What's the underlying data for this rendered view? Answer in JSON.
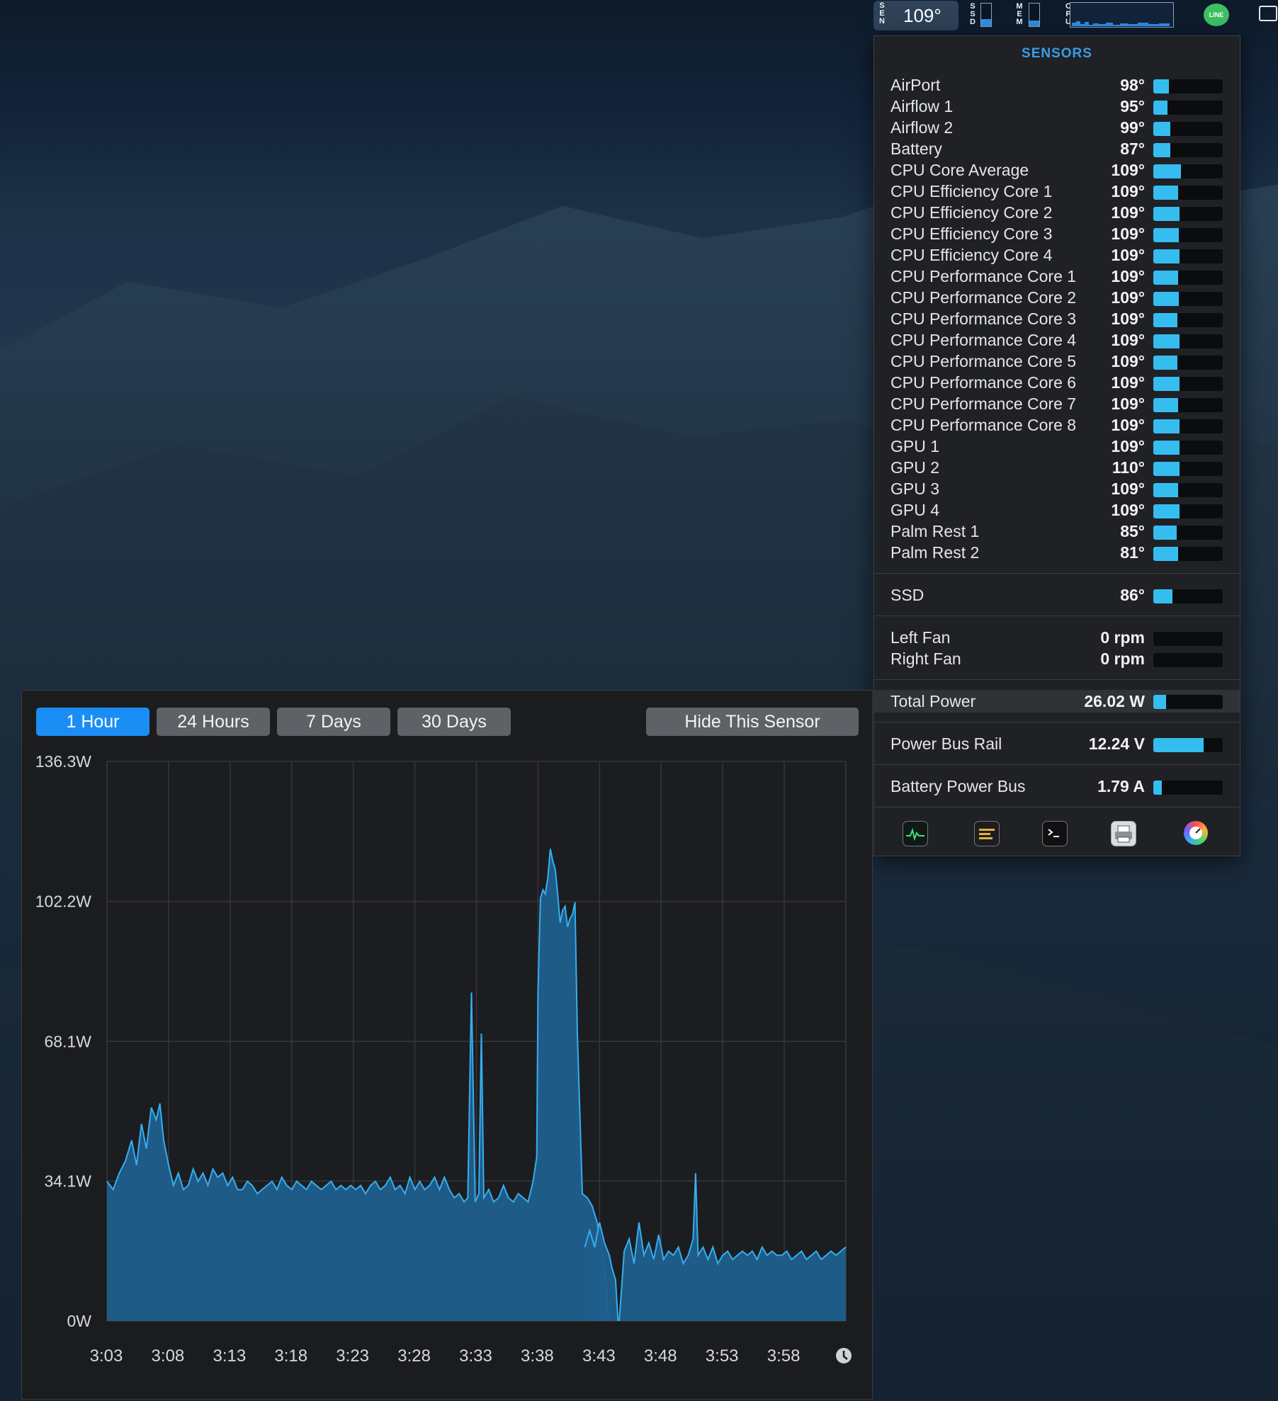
{
  "menubar": {
    "sensor_letters": [
      "S",
      "E",
      "N"
    ],
    "sensor_temp": "109°",
    "ssd_letters": [
      "S",
      "S",
      "D"
    ],
    "mem_letters": [
      "M",
      "E",
      "M"
    ],
    "cpu_letters": [
      "C",
      "P",
      "U"
    ],
    "ssd_level": 0.3,
    "mem_level": 0.25,
    "line_app_label": "LINE",
    "display_icon": "display-icon"
  },
  "sensors_panel": {
    "title": "SENSORS",
    "temperatures": [
      {
        "label": "AirPort",
        "value": "98°",
        "level": 0.22
      },
      {
        "label": "Airflow 1",
        "value": "95°",
        "level": 0.2
      },
      {
        "label": "Airflow 2",
        "value": "99°",
        "level": 0.24
      },
      {
        "label": "Battery",
        "value": "87°",
        "level": 0.24
      },
      {
        "label": "CPU Core Average",
        "value": "109°",
        "level": 0.4
      },
      {
        "label": "CPU Efficiency Core 1",
        "value": "109°",
        "level": 0.36
      },
      {
        "label": "CPU Efficiency Core 2",
        "value": "109°",
        "level": 0.38
      },
      {
        "label": "CPU Efficiency Core 3",
        "value": "109°",
        "level": 0.37
      },
      {
        "label": "CPU Efficiency Core 4",
        "value": "109°",
        "level": 0.38
      },
      {
        "label": "CPU Performance Core 1",
        "value": "109°",
        "level": 0.36
      },
      {
        "label": "CPU Performance Core 2",
        "value": "109°",
        "level": 0.37
      },
      {
        "label": "CPU Performance Core 3",
        "value": "109°",
        "level": 0.35
      },
      {
        "label": "CPU Performance Core 4",
        "value": "109°",
        "level": 0.38
      },
      {
        "label": "CPU Performance Core 5",
        "value": "109°",
        "level": 0.35
      },
      {
        "label": "CPU Performance Core 6",
        "value": "109°",
        "level": 0.38
      },
      {
        "label": "CPU Performance Core 7",
        "value": "109°",
        "level": 0.36
      },
      {
        "label": "CPU Performance Core 8",
        "value": "109°",
        "level": 0.38
      },
      {
        "label": "GPU 1",
        "value": "109°",
        "level": 0.38
      },
      {
        "label": "GPU 2",
        "value": "110°",
        "level": 0.38
      },
      {
        "label": "GPU 3",
        "value": "109°",
        "level": 0.36
      },
      {
        "label": "GPU 4",
        "value": "109°",
        "level": 0.38
      },
      {
        "label": "Palm Rest 1",
        "value": "85°",
        "level": 0.34
      },
      {
        "label": "Palm Rest 2",
        "value": "81°",
        "level": 0.36
      }
    ],
    "ssd": {
      "label": "SSD",
      "value": "86°",
      "level": 0.28
    },
    "fans": [
      {
        "label": "Left Fan",
        "value": "0 rpm",
        "level": 0
      },
      {
        "label": "Right Fan",
        "value": "0 rpm",
        "level": 0
      }
    ],
    "total_power": {
      "label": "Total Power",
      "value": "26.02 W",
      "level": 0.18
    },
    "power_bus": {
      "label": "Power Bus Rail",
      "value": "12.24 V",
      "level": 0.72
    },
    "battery_bus": {
      "label": "Battery Power Bus",
      "value": "1.79 A",
      "level": 0.12
    },
    "toolbar_icons": [
      "activity-monitor-icon",
      "console-icon",
      "terminal-icon",
      "printer-icon",
      "istat-icon"
    ]
  },
  "chart_window": {
    "buttons": [
      "1 Hour",
      "24 Hours",
      "7 Days",
      "30 Days"
    ],
    "active_button": "1 Hour",
    "hide_button": "Hide This Sensor",
    "clock_icon": "clock-icon"
  },
  "chart_data": {
    "type": "area",
    "title": "",
    "xlabel": "",
    "ylabel": "",
    "ylim": [
      0,
      136.3
    ],
    "ytick_labels": [
      "136.3W",
      "102.2W",
      "68.1W",
      "34.1W",
      "0W"
    ],
    "yticks": [
      136.3,
      102.2,
      68.1,
      34.1,
      0
    ],
    "xtick_labels": [
      "3:03",
      "3:08",
      "3:13",
      "3:18",
      "3:23",
      "3:28",
      "3:33",
      "3:38",
      "3:43",
      "3:48",
      "3:53",
      "3:58"
    ],
    "x_minutes": [
      0,
      60
    ],
    "grid": true,
    "series": [
      {
        "color": "#35aef0",
        "segments": [
          [
            [
              0,
              34
            ],
            [
              0.5,
              32
            ],
            [
              1,
              36
            ],
            [
              1.5,
              39
            ],
            [
              2,
              44
            ],
            [
              2.4,
              38
            ],
            [
              2.8,
              48
            ],
            [
              3.2,
              42
            ],
            [
              3.6,
              52
            ],
            [
              4,
              49
            ],
            [
              4.3,
              53
            ],
            [
              4.6,
              44
            ],
            [
              5,
              38
            ],
            [
              5.4,
              33
            ],
            [
              5.8,
              36
            ],
            [
              6.2,
              32
            ],
            [
              6.6,
              33
            ],
            [
              7,
              37
            ],
            [
              7.4,
              34
            ],
            [
              7.8,
              36
            ],
            [
              8.2,
              33
            ],
            [
              8.6,
              37
            ],
            [
              9,
              35
            ],
            [
              9.4,
              36
            ],
            [
              9.8,
              33
            ],
            [
              10.2,
              35
            ],
            [
              10.6,
              32
            ],
            [
              11,
              32
            ],
            [
              11.4,
              34
            ],
            [
              11.8,
              33
            ],
            [
              12.2,
              31
            ],
            [
              12.6,
              32
            ],
            [
              13,
              33
            ],
            [
              13.4,
              34
            ],
            [
              13.8,
              32
            ],
            [
              14.2,
              35
            ],
            [
              14.6,
              33
            ],
            [
              15,
              32
            ],
            [
              15.4,
              34
            ],
            [
              15.8,
              33
            ],
            [
              16.2,
              32
            ],
            [
              16.6,
              34
            ],
            [
              17,
              33
            ],
            [
              17.4,
              32
            ],
            [
              17.8,
              33
            ],
            [
              18.2,
              34
            ],
            [
              18.6,
              32
            ],
            [
              19,
              33
            ],
            [
              19.4,
              32
            ],
            [
              19.8,
              33
            ],
            [
              20.2,
              32
            ],
            [
              20.6,
              33
            ],
            [
              21,
              31
            ],
            [
              21.4,
              33
            ],
            [
              21.8,
              34
            ],
            [
              22.2,
              32
            ],
            [
              22.6,
              33
            ],
            [
              23,
              35
            ],
            [
              23.4,
              32
            ],
            [
              23.8,
              33
            ],
            [
              24.2,
              31
            ],
            [
              24.6,
              35
            ],
            [
              25,
              32
            ],
            [
              25.4,
              34
            ],
            [
              25.8,
              32
            ],
            [
              26.2,
              33
            ],
            [
              26.6,
              35
            ],
            [
              27,
              32
            ],
            [
              27.4,
              35
            ],
            [
              27.8,
              32
            ],
            [
              28.2,
              30
            ],
            [
              28.6,
              31
            ],
            [
              29,
              29
            ],
            [
              29.3,
              30
            ],
            [
              29.6,
              80
            ],
            [
              29.9,
              29
            ],
            [
              30.2,
              31
            ],
            [
              30.4,
              70
            ],
            [
              30.6,
              30
            ],
            [
              31,
              32
            ],
            [
              31.4,
              29
            ],
            [
              31.8,
              30
            ],
            [
              32.2,
              33
            ],
            [
              32.6,
              30
            ],
            [
              33,
              29
            ],
            [
              33.4,
              31
            ],
            [
              33.8,
              30
            ],
            [
              34.2,
              29
            ],
            [
              34.6,
              34
            ],
            [
              34.9,
              40
            ],
            [
              35,
              80
            ],
            [
              35.2,
              103
            ],
            [
              35.4,
              105
            ],
            [
              35.6,
              104
            ],
            [
              35.8,
              108
            ],
            [
              36,
              115
            ],
            [
              36.2,
              112
            ],
            [
              36.4,
              110
            ],
            [
              36.6,
              104
            ],
            [
              36.8,
              97
            ],
            [
              37,
              100
            ],
            [
              37.2,
              101
            ],
            [
              37.4,
              96
            ],
            [
              37.6,
              98
            ],
            [
              37.8,
              99
            ],
            [
              38,
              102
            ],
            [
              38.2,
              70
            ],
            [
              38.6,
              31
            ],
            [
              39,
              30
            ],
            [
              39.4,
              28
            ],
            [
              39.8,
              24
            ],
            [
              40.2,
              18
            ],
            [
              40.6,
              8
            ],
            [
              40.7,
              0
            ]
          ],
          [
            [
              38.8,
              18
            ],
            [
              39.2,
              22
            ],
            [
              39.6,
              18
            ],
            [
              40,
              24
            ],
            [
              40.4,
              19
            ],
            [
              40.8,
              16
            ],
            [
              41,
              13
            ],
            [
              41.3,
              10
            ],
            [
              41.5,
              0
            ]
          ],
          [
            [
              41.6,
              0
            ],
            [
              42,
              17
            ],
            [
              42.4,
              20
            ],
            [
              42.8,
              14
            ],
            [
              43.2,
              24
            ],
            [
              43.6,
              16
            ],
            [
              44,
              19
            ],
            [
              44.4,
              15
            ],
            [
              44.8,
              21
            ],
            [
              45.2,
              15
            ],
            [
              45.6,
              17
            ],
            [
              46,
              16
            ],
            [
              46.4,
              18
            ],
            [
              46.8,
              14
            ],
            [
              47.2,
              16
            ],
            [
              47.6,
              20
            ],
            [
              47.8,
              36
            ],
            [
              48,
              16
            ],
            [
              48.4,
              18
            ],
            [
              48.8,
              15
            ],
            [
              49.2,
              18
            ],
            [
              49.6,
              14
            ],
            [
              50,
              16
            ],
            [
              50.4,
              17
            ],
            [
              50.8,
              15
            ],
            [
              51.2,
              16
            ],
            [
              51.6,
              17
            ],
            [
              52,
              16
            ],
            [
              52.4,
              17
            ],
            [
              52.8,
              15
            ],
            [
              53.2,
              18
            ],
            [
              53.6,
              16
            ],
            [
              54,
              17
            ],
            [
              54.4,
              16
            ],
            [
              54.8,
              16
            ],
            [
              55.2,
              17
            ],
            [
              55.6,
              15
            ],
            [
              56,
              16
            ],
            [
              56.4,
              17
            ],
            [
              56.8,
              15
            ],
            [
              57.2,
              16
            ],
            [
              57.6,
              17
            ],
            [
              58,
              15
            ],
            [
              58.4,
              16
            ],
            [
              58.8,
              17
            ],
            [
              59.2,
              16
            ],
            [
              59.6,
              17
            ],
            [
              60,
              18
            ]
          ]
        ]
      }
    ]
  }
}
